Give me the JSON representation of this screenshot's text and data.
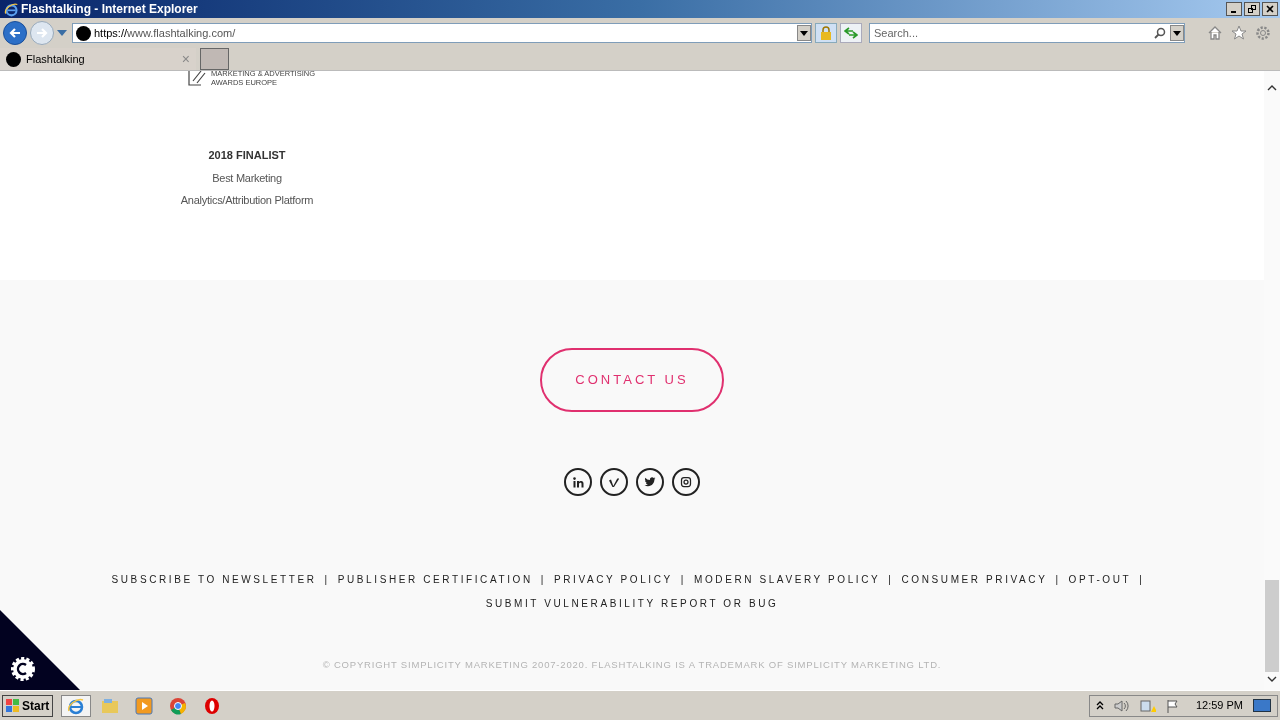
{
  "window": {
    "title": "Flashtalking - Internet Explorer"
  },
  "address_bar": {
    "url_scheme": "https://",
    "url_host": "www.flashtalking.com/"
  },
  "search": {
    "placeholder": "Search..."
  },
  "tabs": [
    {
      "label": "Flashtalking",
      "selected": true,
      "close": "×"
    }
  ],
  "award": {
    "logo_lines": [
      "MARKETING & ADVERTISING",
      "AWARDS EUROPE"
    ],
    "heading": "2018 FINALIST",
    "lines": [
      "Best Marketing",
      "Analytics/Attribution Platform"
    ]
  },
  "contact_button": "CONTACT US",
  "social": [
    {
      "kind": "linkedin"
    },
    {
      "kind": "vimeo"
    },
    {
      "kind": "twitter"
    },
    {
      "kind": "instagram"
    }
  ],
  "footer_links": [
    {
      "label": "SUBSCRIBE TO NEWSLETTER",
      "separator": "|"
    },
    {
      "label": "PUBLISHER CERTIFICATION",
      "separator": "|"
    },
    {
      "label": "PRIVACY POLICY",
      "separator": "|"
    },
    {
      "label": "MODERN SLAVERY POLICY",
      "separator": "|"
    },
    {
      "label": "CONSUMER PRIVACY",
      "separator": "|"
    },
    {
      "label": "OPT-OUT",
      "separator": "|"
    },
    {
      "label": "SUBMIT VULNERABILITY REPORT OR BUG"
    }
  ],
  "copyright": "© COPYRIGHT SIMPLICITY MARKETING 2007-2020. FLASHTALKING IS A TRADEMARK OF SIMPLICITY MARKETING LTD.",
  "taskbar": {
    "start": "Start",
    "apps": [
      {
        "kind": "ie",
        "selected": true
      },
      {
        "kind": "explorer",
        "selected": false
      },
      {
        "kind": "media",
        "selected": false
      },
      {
        "kind": "chrome",
        "selected": false
      },
      {
        "kind": "opera",
        "selected": false
      }
    ],
    "clock": "12:59 PM"
  }
}
